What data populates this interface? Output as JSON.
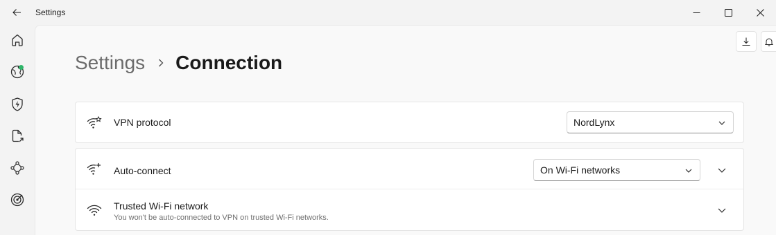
{
  "window": {
    "title": "Settings",
    "back_icon": "arrow-left-icon",
    "controls": [
      "minimize-icon",
      "maximize-icon",
      "close-icon"
    ]
  },
  "rail": {
    "items": [
      {
        "icon": "home-icon"
      },
      {
        "icon": "globe-icon",
        "status": "connected",
        "status_color": "#2fb569"
      },
      {
        "icon": "shield-bolt-icon"
      },
      {
        "icon": "file-share-icon"
      },
      {
        "icon": "meshnet-icon"
      },
      {
        "icon": "target-icon"
      }
    ]
  },
  "top_actions": [
    "download-icon",
    "bell-icon"
  ],
  "breadcrumb": {
    "parent": "Settings",
    "current": "Connection"
  },
  "settings": {
    "vpn_protocol": {
      "label": "VPN protocol",
      "value": "NordLynx"
    },
    "auto_connect": {
      "label": "Auto-connect",
      "value": "On Wi-Fi networks"
    },
    "trusted_wifi": {
      "label": "Trusted Wi-Fi network",
      "description": "You won't be auto-connected to VPN on trusted Wi-Fi networks."
    }
  },
  "colors": {
    "accent_green": "#2fb569",
    "background": "#f3f3f3",
    "panel": "#f9f9f9"
  }
}
